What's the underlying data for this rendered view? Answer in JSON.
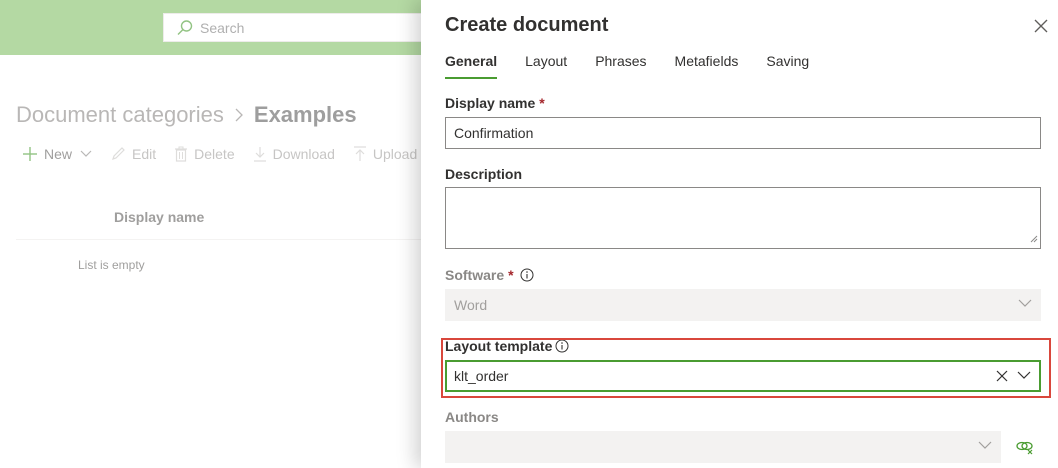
{
  "search": {
    "placeholder": "Search"
  },
  "breadcrumb": {
    "parent": "Document categories",
    "current": "Examples"
  },
  "toolbar": {
    "new": "New",
    "edit": "Edit",
    "delete": "Delete",
    "download": "Download",
    "upload": "Upload"
  },
  "list": {
    "column_display_name": "Display name",
    "empty_text": "List is empty"
  },
  "panel": {
    "title": "Create document",
    "tabs": [
      "General",
      "Layout",
      "Phrases",
      "Metafields",
      "Saving"
    ],
    "display_name": {
      "label": "Display name",
      "required": "*",
      "value": "Confirmation"
    },
    "description": {
      "label": "Description",
      "value": ""
    },
    "software": {
      "label": "Software",
      "required": "*",
      "value": "Word"
    },
    "layout_template": {
      "label": "Layout template",
      "value": "klt_order"
    },
    "authors": {
      "label": "Authors",
      "value": ""
    }
  },
  "colors": {
    "brand": "#83c067",
    "accent": "#4a9c31",
    "highlight": "#d9473c",
    "required": "#a4262c"
  },
  "icons": [
    "search-icon",
    "chevron-right-icon",
    "add-icon",
    "chevron-down-icon",
    "edit-icon",
    "delete-icon",
    "download-icon",
    "upload-icon",
    "close-icon",
    "info-icon",
    "clear-icon",
    "link-people-icon"
  ]
}
